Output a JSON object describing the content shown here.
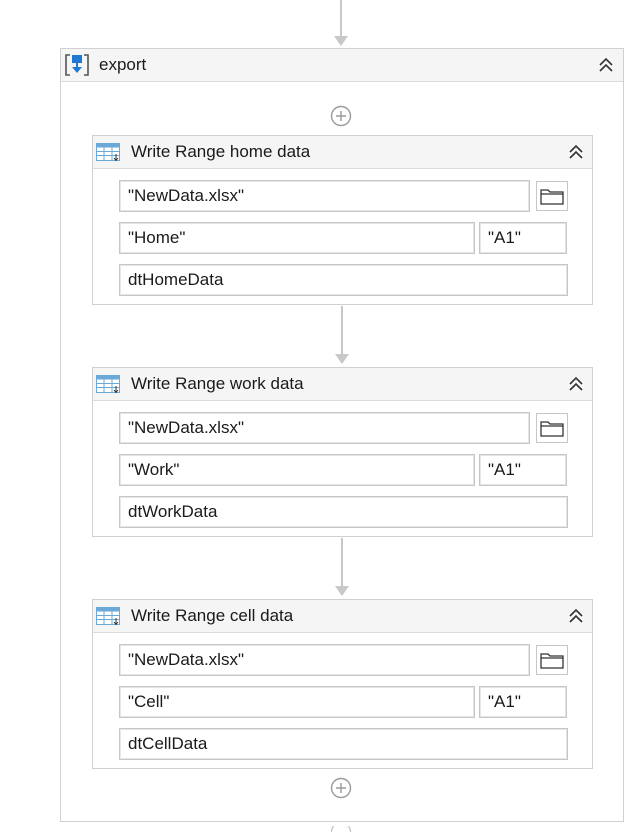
{
  "sequence": {
    "title": "export",
    "icon": "sequence-icon",
    "collapse_icon": "double-chevron-up-icon",
    "add_icon": "plus-circle-icon"
  },
  "activities": [
    {
      "title": "Write Range home data",
      "icon": "write-range-icon",
      "workbook_path": "\"NewData.xlsx\"",
      "sheet_name": "\"Home\"",
      "starting_cell": "\"A1\"",
      "data_table": "dtHomeData"
    },
    {
      "title": "Write Range work data",
      "icon": "write-range-icon",
      "workbook_path": "\"NewData.xlsx\"",
      "sheet_name": "\"Work\"",
      "starting_cell": "\"A1\"",
      "data_table": "dtWorkData"
    },
    {
      "title": "Write Range cell data",
      "icon": "write-range-icon",
      "workbook_path": "\"NewData.xlsx\"",
      "sheet_name": "\"Cell\"",
      "starting_cell": "\"A1\"",
      "data_table": "dtCellData"
    }
  ],
  "colors": {
    "accent_blue": "#1f78d1",
    "connector": "#c8c8c8"
  }
}
